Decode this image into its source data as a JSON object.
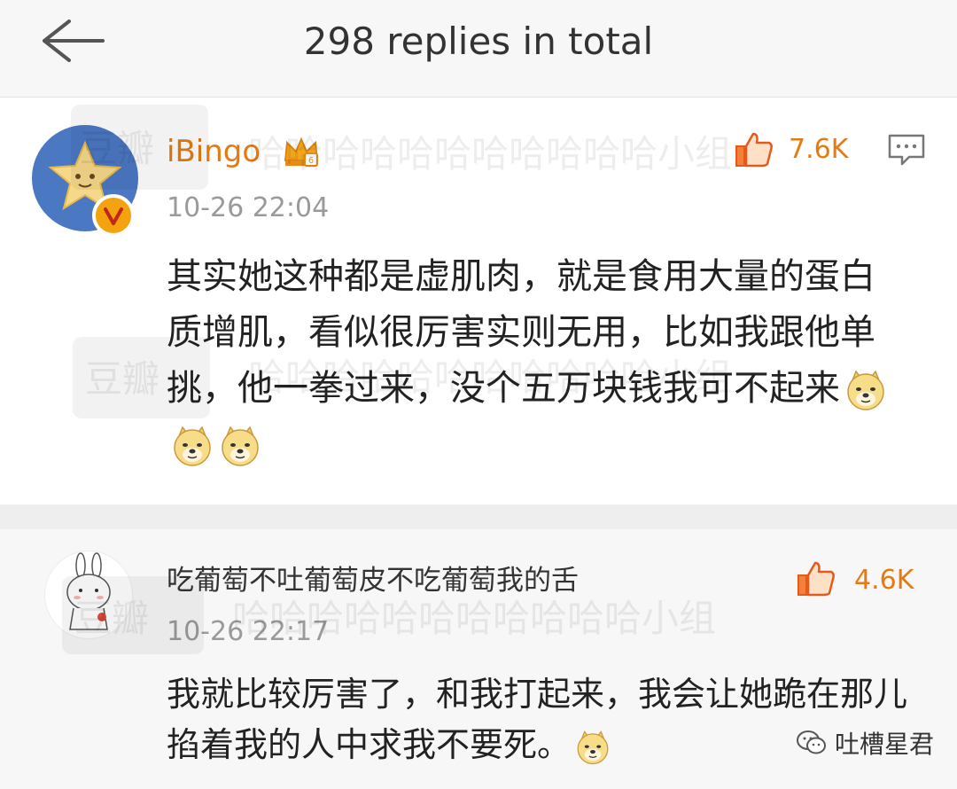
{
  "header": {
    "title": "298 replies in total",
    "back_icon": "arrow-left-icon"
  },
  "comments": [
    {
      "username": "iBingo",
      "badge_icon": "crown-icon",
      "verified_icon": "verified-v-icon",
      "timestamp": "10-26 22:04",
      "likes": "7.6K",
      "like_icon": "thumbs-up-icon",
      "reply_icon": "comment-icon",
      "text": "其实她这种都是虚肌肉，就是食用大量的蛋白质增肌，看似很厉害实则无用，比如我跟他单挑，他一拳过来，没个五万块钱我可不起来",
      "emoji_count": 3,
      "emoji_icon": "doge-emoji-icon"
    },
    {
      "username": "吃葡萄不吐葡萄皮不吃葡萄我的舌",
      "timestamp": "10-26 22:17",
      "likes": "4.6K",
      "like_icon": "thumbs-up-icon",
      "text": "我就比较厉害了，和我打起来，我会让她跪在那儿掐着我的人中求我不要死。",
      "emoji_count": 1,
      "emoji_icon": "doge-emoji-icon"
    }
  ],
  "watermarks": {
    "site": "豆瓣",
    "group": "哈哈哈哈哈哈哈哈哈哈哈小组"
  },
  "corner_logo": {
    "text": "吐槽星君",
    "icon": "wechat-icon"
  },
  "colors": {
    "accent": "#e57a11",
    "header_bg": "#f7f7f7",
    "divider": "#eeeeee",
    "timestamp": "#9a9a9a"
  }
}
